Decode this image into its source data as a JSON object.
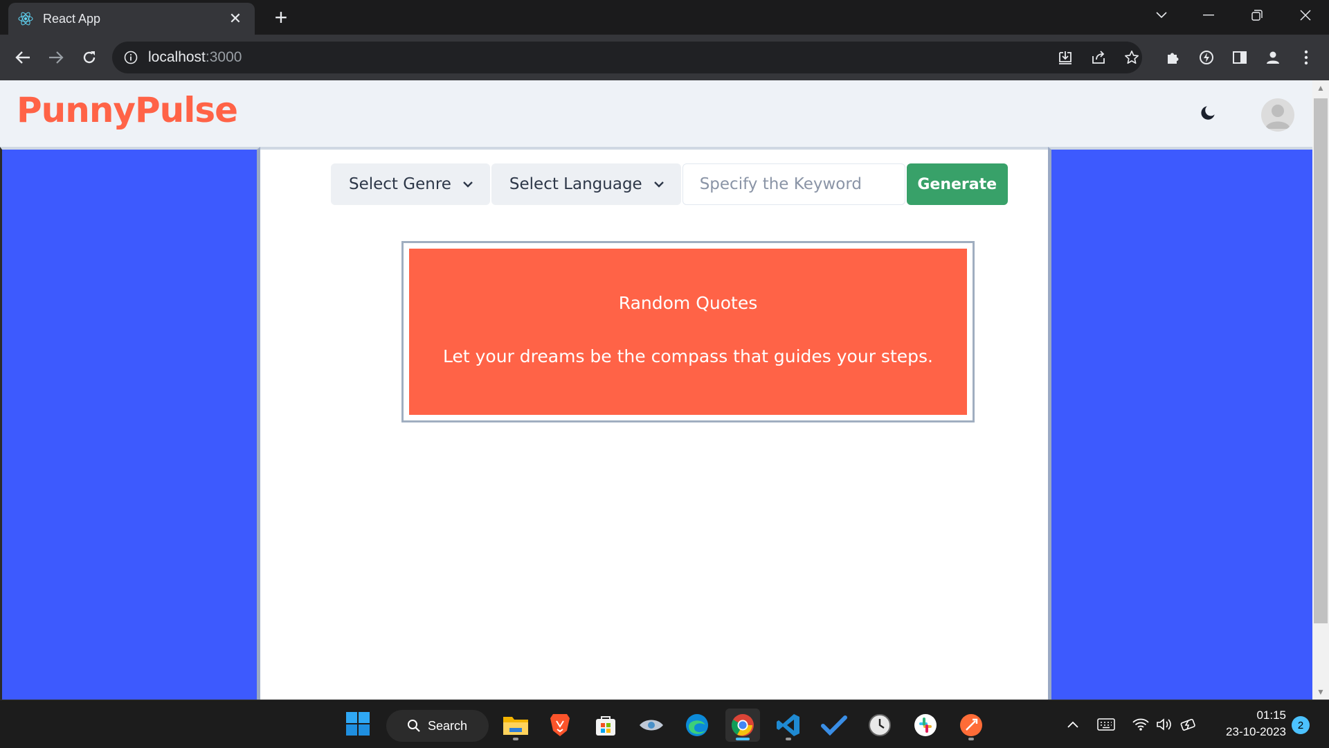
{
  "browser": {
    "tab_title": "React App",
    "tab_close": "✕",
    "new_tab": "+",
    "url_host": "localhost",
    "url_port": ":3000"
  },
  "app": {
    "brand": "PunnyPulse",
    "brand_color": "#ff6347",
    "genre_dropdown": "Select Genre",
    "language_dropdown": "Select Language",
    "keyword_placeholder": "Specify the Keyword",
    "keyword_value": "",
    "generate_label": "Generate",
    "generate_color": "#38a169",
    "side_panel_color": "#3d5afe",
    "quote_card_color": "#ff6347",
    "quote_title": "Random Quotes",
    "quote_text": "Let your dreams be the compass that guides your steps."
  },
  "taskbar": {
    "search_label": "Search",
    "time": "01:15",
    "date": "23-10-2023",
    "notification_count": "2",
    "apps": [
      "start",
      "file-explorer",
      "brave",
      "microsoft-store",
      "eye-app",
      "edge",
      "chrome",
      "vscode",
      "todo",
      "clock",
      "slack",
      "postman"
    ]
  }
}
